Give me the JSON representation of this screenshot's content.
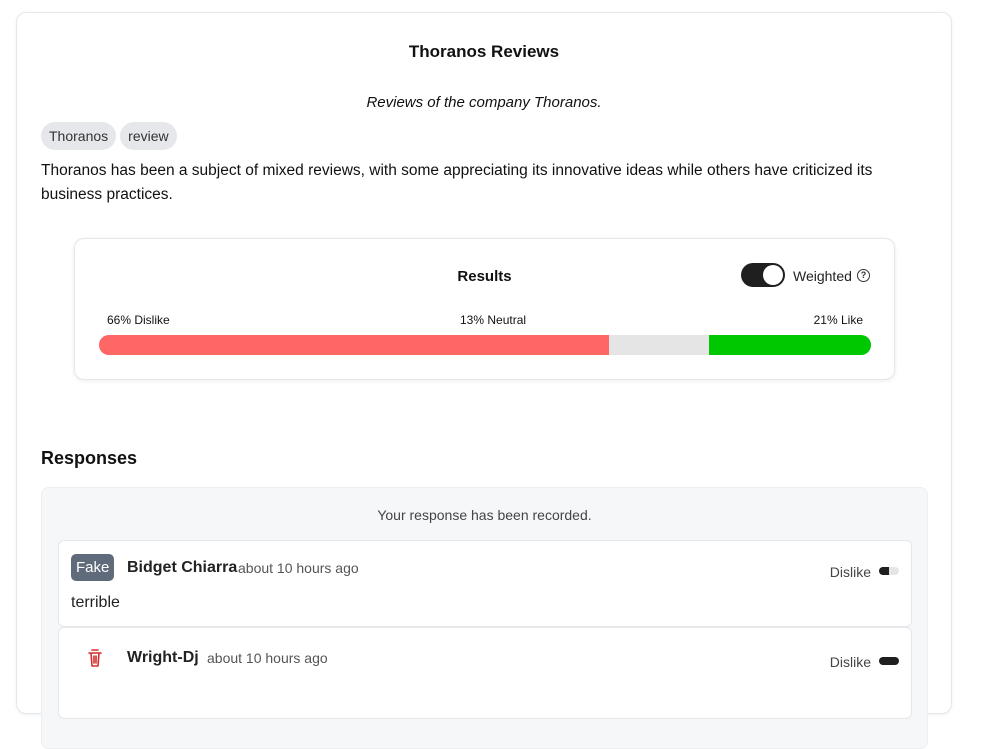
{
  "page": {
    "title": "Thoranos Reviews",
    "subtitle": "Reviews of the company Thoranos.",
    "tags": [
      "Thoranos",
      "review"
    ],
    "description": "Thoranos has been a subject of mixed reviews, with some appreciating its innovative ideas while others have criticized its business practices."
  },
  "results": {
    "title": "Results",
    "weighted_label": "Weighted",
    "weighted_on": true,
    "dislike_label": "66% Dislike",
    "neutral_label": "13% Neutral",
    "like_label": "21% Like",
    "dislike_pct": 66,
    "neutral_pct": 13,
    "like_pct": 21,
    "colors": {
      "dislike": "#ff6666",
      "neutral": "#e5e5e5",
      "like": "#00c800"
    }
  },
  "responses": {
    "heading": "Responses",
    "recorded_message": "Your response has been recorded.",
    "items": [
      {
        "badge": "Fake",
        "author": "Bidget Chiarra",
        "time": "about 10 hours ago",
        "sentiment": "Dislike",
        "level": 0.5,
        "comment": "terrible"
      },
      {
        "icon": "trash-icon",
        "author": "Wright-Dj",
        "time": "about 10 hours ago",
        "sentiment": "Dislike",
        "level": 1.0
      }
    ]
  }
}
